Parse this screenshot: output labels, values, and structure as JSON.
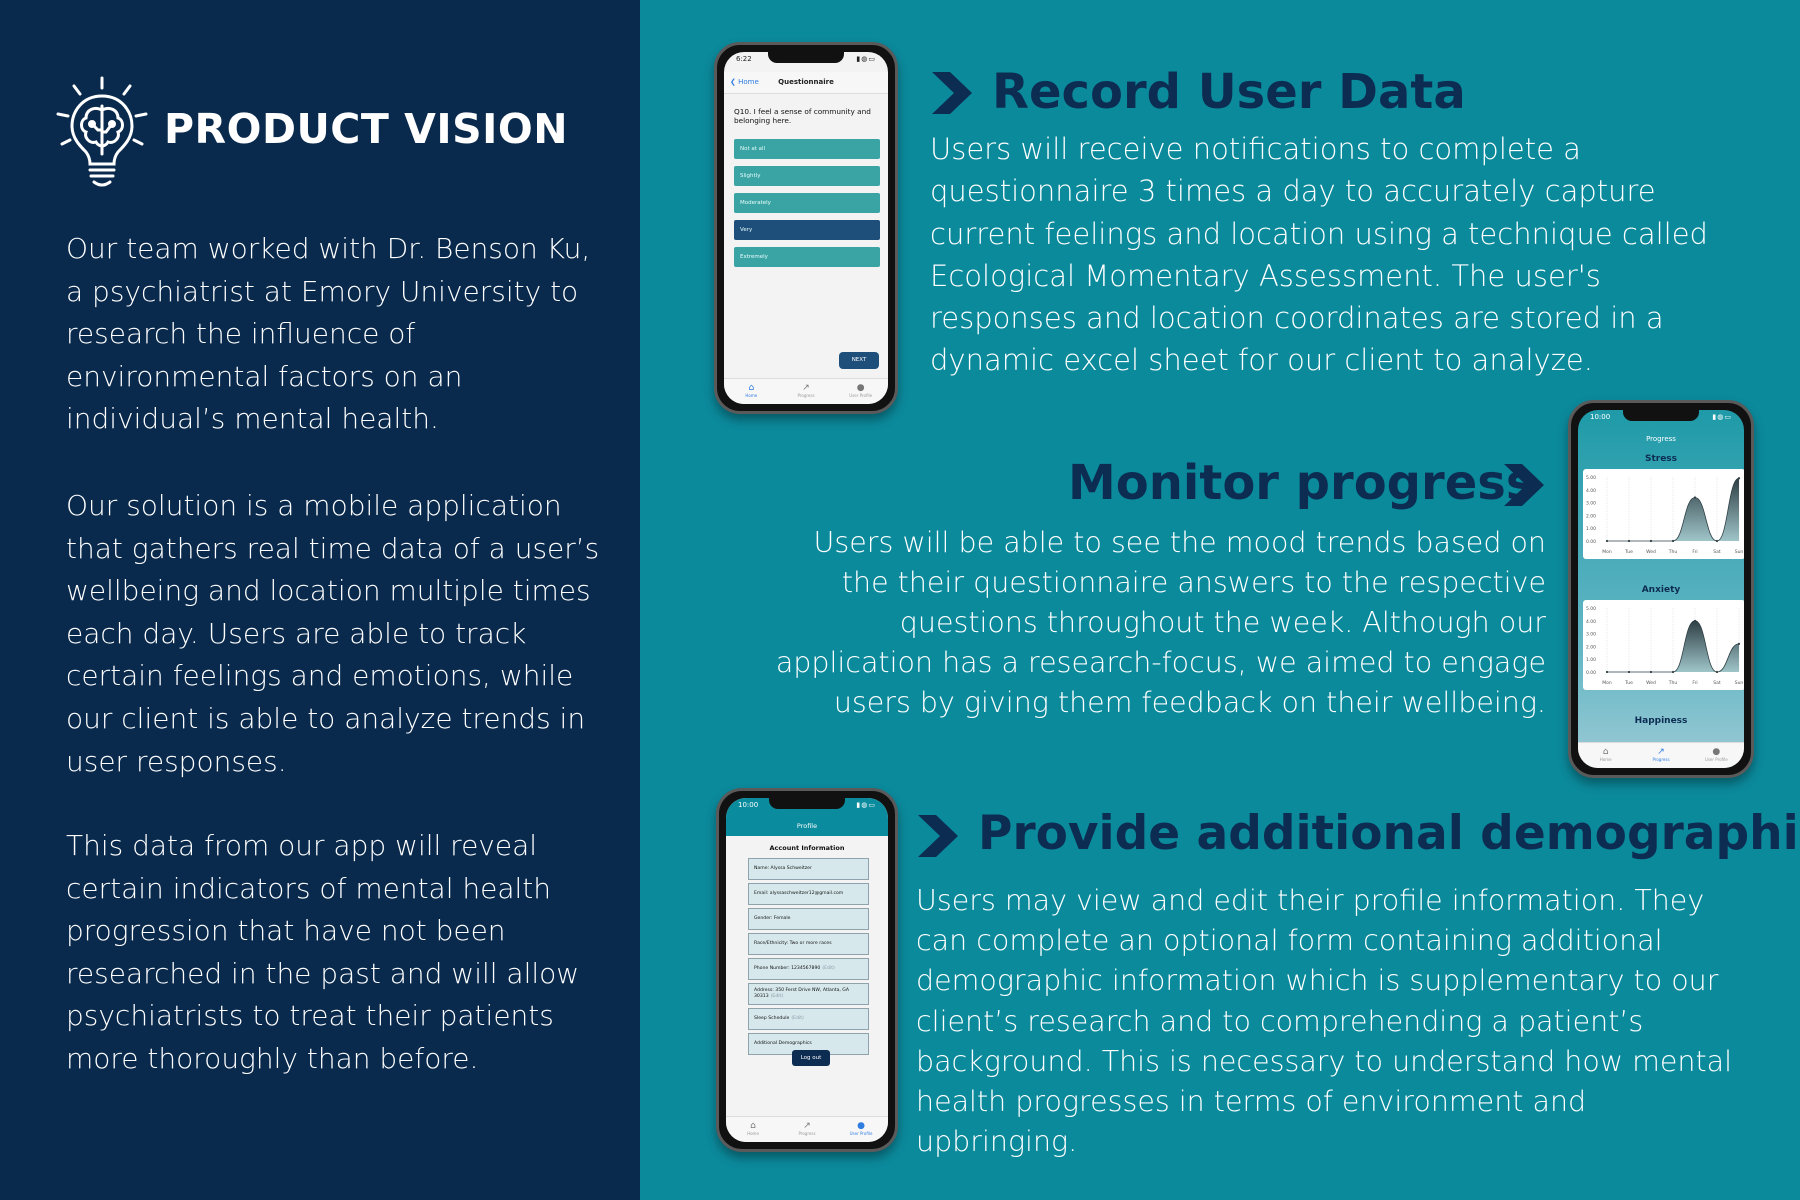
{
  "left": {
    "title": "PRODUCT VISION",
    "paragraphs": [
      "Our team worked with Dr. Benson Ku, a psychiatrist at Emory University to research the influence of environmental factors on an individual’s mental health.",
      "Our solution is a mobile application that gathers real time data of a user’s wellbeing and location multiple times each day. Users are able to track certain feelings and emotions, while our client is able to analyze trends in user responses.",
      "This data from our app will reveal certain indicators of mental health progression that have not been researched in the past and will allow psychiatrists to treat their patients more thoroughly than before."
    ]
  },
  "sections": [
    {
      "heading": "Record User Data",
      "body": "Users will receive notifications to complete a questionnaire 3 times a day to accurately capture current feelings and location using a technique called Ecological Momentary Assessment. The user's responses and location coordinates are stored in a dynamic excel sheet for our client to analyze."
    },
    {
      "heading": "Monitor progress",
      "body": "Users will be able to see the mood trends based on the their questionnaire answers to the respective questions throughout the week. Although our application has a research-focus, we aimed to engage users by giving them feedback on their wellbeing."
    },
    {
      "heading": "Provide additional demographics",
      "body": "Users may view and edit their profile information. They can complete an optional form containing additional demographic information which is supplementary to our client’s research and to comprehending a patient’s background. This is necessary to understand how mental health progresses in terms of environment and upbringing."
    }
  ],
  "phone_questionnaire": {
    "time": "6:22",
    "back_label": "Home",
    "title": "Questionnaire",
    "question": "Q10. I feel a sense of community and belonging here.",
    "options": [
      "Not at all",
      "Slightly",
      "Moderately",
      "Very",
      "Extremely"
    ],
    "selected_option": "Very",
    "next_label": "NEXT",
    "tabs": [
      "Home",
      "Progress",
      "User Profile"
    ],
    "active_tab": "Home"
  },
  "phone_progress": {
    "time": "10:00",
    "title": "Progress",
    "charts": [
      {
        "label": "Stress",
        "y_ticks": [
          "5.00",
          "4.00",
          "3.00",
          "2.00",
          "1.00",
          "0.00"
        ],
        "days": [
          "Mon",
          "Tue",
          "Wed",
          "Thu",
          "Fri",
          "Sat",
          "Sun"
        ],
        "values": [
          0,
          0,
          0,
          0,
          3.4,
          0,
          4.9
        ]
      },
      {
        "label": "Anxiety",
        "y_ticks": [
          "5.00",
          "4.00",
          "3.00",
          "2.00",
          "1.00",
          "0.00"
        ],
        "days": [
          "Mon",
          "Tue",
          "Wed",
          "Thu",
          "Fri",
          "Sat",
          "Sun"
        ],
        "values": [
          0,
          0,
          0,
          0,
          4,
          0,
          2.2
        ]
      }
    ],
    "next_label": "Happiness",
    "tabs": [
      "Home",
      "Progress",
      "User Profile"
    ],
    "active_tab": "Progress"
  },
  "phone_profile": {
    "time": "10:00",
    "title": "Profile",
    "subtitle": "Account Information",
    "fields": [
      {
        "label": "Name: Alyssa Schweitzer",
        "edit": ""
      },
      {
        "label": "Email: alyssaschweitzer12@gmail.com",
        "edit": ""
      },
      {
        "label": "Gender: Female",
        "edit": ""
      },
      {
        "label": "Race/Ethnicity: Two or more races",
        "edit": ""
      },
      {
        "label": "Phone Number: 1234567890",
        "edit": "(Edit)"
      },
      {
        "label": "Address: 350 Ferst Drive NW, Atlanta, GA 30313",
        "edit": "(Edit)"
      },
      {
        "label": "Sleep Schedule",
        "edit": "(Edit)"
      },
      {
        "label": "Additional Demographics",
        "edit": ""
      }
    ],
    "logout_label": "Log out",
    "tabs": [
      "Home",
      "Progress",
      "User Profile"
    ],
    "active_tab": "User Profile"
  },
  "colors": {
    "left_bg": "#0a2a4d",
    "right_bg": "#0b8a9c",
    "heading": "#0d2c52",
    "option": "#3aa3a3",
    "option_selected": "#1e4f7a"
  }
}
